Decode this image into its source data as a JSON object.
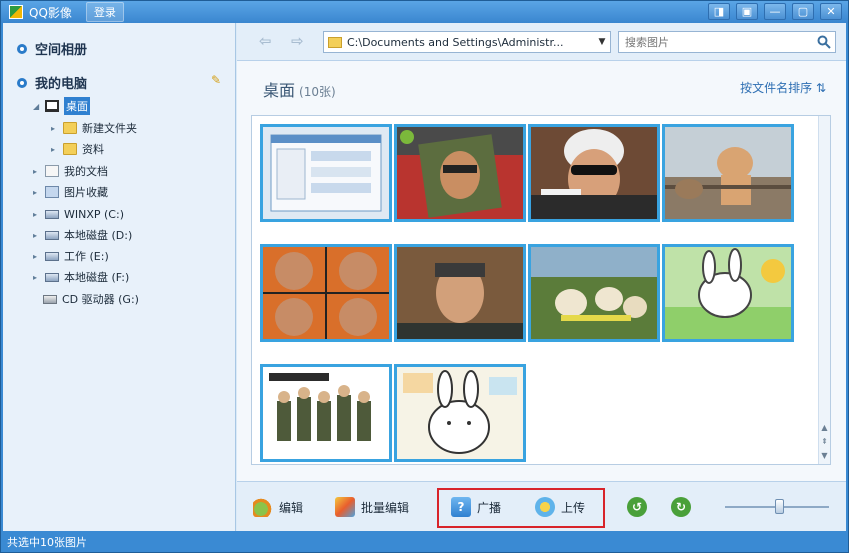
{
  "titlebar": {
    "title": "QQ影像",
    "login": "登录",
    "controls": [
      "◨",
      "▣",
      "—",
      "▢",
      "✕"
    ]
  },
  "sidebar": {
    "space_album": "空间相册",
    "my_computer": "我的电脑",
    "tree": {
      "desktop": "桌面",
      "new_folder": "新建文件夹",
      "materials": "资料",
      "my_docs": "我的文档",
      "pic_fav": "图片收藏",
      "drive_c": "WINXP (C:)",
      "drive_d": "本地磁盘 (D:)",
      "drive_e": "工作 (E:)",
      "drive_f": "本地磁盘 (F:)",
      "drive_g": "CD 驱动器 (G:)"
    }
  },
  "toolbar": {
    "path": "C:\\Documents and Settings\\Administr...",
    "search_placeholder": "搜索图片"
  },
  "folder": {
    "title": "桌面",
    "count": "(10张)",
    "sort": "按文件名排序"
  },
  "actions": {
    "edit": "编辑",
    "batch_edit": "批量编辑",
    "broadcast": "广播",
    "upload": "上传"
  },
  "status": {
    "text": "共选中10张图片"
  },
  "colors": {
    "accent": "#2f80d0",
    "selection_border": "#39a3e0",
    "highlight": "#d8232a"
  }
}
